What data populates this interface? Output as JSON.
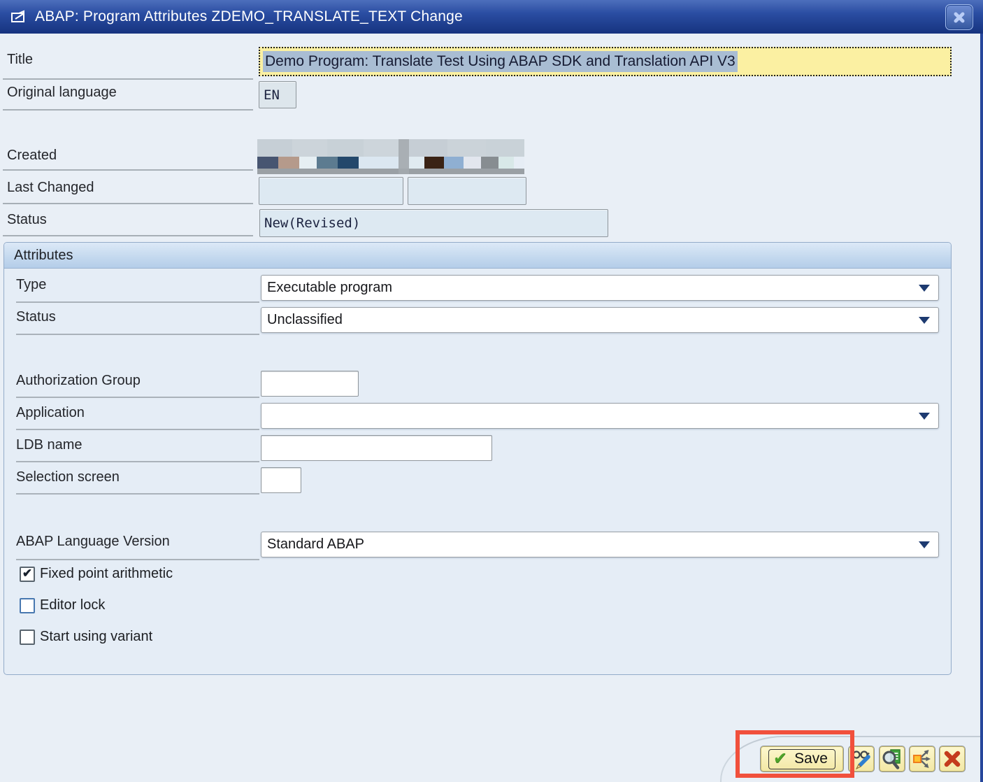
{
  "window": {
    "title": "ABAP: Program Attributes ZDEMO_TRANSLATE_TEXT Change"
  },
  "fields": {
    "title": {
      "label": "Title",
      "value": "Demo Program: Translate Test Using ABAP SDK and Translation API V3"
    },
    "original_language": {
      "label": "Original language",
      "value": "EN"
    },
    "created": {
      "label": "Created",
      "redacted": true
    },
    "last_changed": {
      "label": "Last Changed",
      "value1": "",
      "value2": ""
    },
    "status": {
      "label": "Status",
      "value": "New(Revised)"
    }
  },
  "attributes": {
    "header": "Attributes",
    "type": {
      "label": "Type",
      "value": "Executable program"
    },
    "status": {
      "label": "Status",
      "value": "Unclassified"
    },
    "authorization_group": {
      "label": "Authorization Group",
      "value": ""
    },
    "application": {
      "label": "Application",
      "value": ""
    },
    "ldb_name": {
      "label": "LDB name",
      "value": ""
    },
    "selection_screen": {
      "label": "Selection screen",
      "value": ""
    },
    "abap_language_version": {
      "label": "ABAP Language Version",
      "value": "Standard ABAP"
    },
    "checkboxes": [
      {
        "label": "Fixed point arithmetic",
        "checked": true
      },
      {
        "label": "Editor lock",
        "checked": false
      },
      {
        "label": "Start using variant",
        "checked": false
      }
    ]
  },
  "footer": {
    "save_label": "Save",
    "icon_buttons": [
      "display-change",
      "check",
      "where-used",
      "cancel"
    ]
  },
  "colors": {
    "titlebar_blue": "#1e3d8f",
    "dialog_bg": "#e9eff6",
    "field_yellow": "#fbf0a2",
    "text_selection": "#a9bdd3",
    "field_blue": "#dde9f2",
    "button_yellow": "#f7eeb4",
    "annotation_red": "#f1503c",
    "check_green": "#4fa32a",
    "cancel_red": "#c43b1c"
  },
  "created_redaction": {
    "rows": [
      {
        "h": 25,
        "cells": [
          [
            50,
            "#c6cfd6"
          ],
          [
            50,
            "#ccd4da"
          ],
          [
            52,
            "#c8d1d7"
          ],
          [
            50,
            "#cdd5db"
          ],
          [
            15,
            "#a9afb4"
          ],
          [
            55,
            "#c6ced5"
          ],
          [
            55,
            "#cbd3d9"
          ],
          [
            55,
            "#c9d2d8"
          ]
        ]
      },
      {
        "h": 17,
        "cells": [
          [
            30,
            "#475571"
          ],
          [
            30,
            "#b59a8b"
          ],
          [
            25,
            "#e6eff3"
          ],
          [
            30,
            "#5c7b90"
          ],
          [
            30,
            "#24486b"
          ],
          [
            57,
            "#dbe7f1"
          ],
          [
            15,
            "#a9afb4"
          ],
          [
            22,
            "#e0ebf1"
          ],
          [
            28,
            "#3a2315"
          ],
          [
            28,
            "#8fafd2"
          ],
          [
            25,
            "#e2e6ee"
          ],
          [
            25,
            "#878d91"
          ],
          [
            22,
            "#d8e8e8"
          ],
          [
            15,
            "#e6edf5"
          ]
        ]
      },
      {
        "h": 8,
        "cells": [
          [
            202,
            "#9aa0a5"
          ],
          [
            15,
            "#a2a8ad"
          ],
          [
            165,
            "#9aa0a5"
          ]
        ]
      }
    ]
  }
}
